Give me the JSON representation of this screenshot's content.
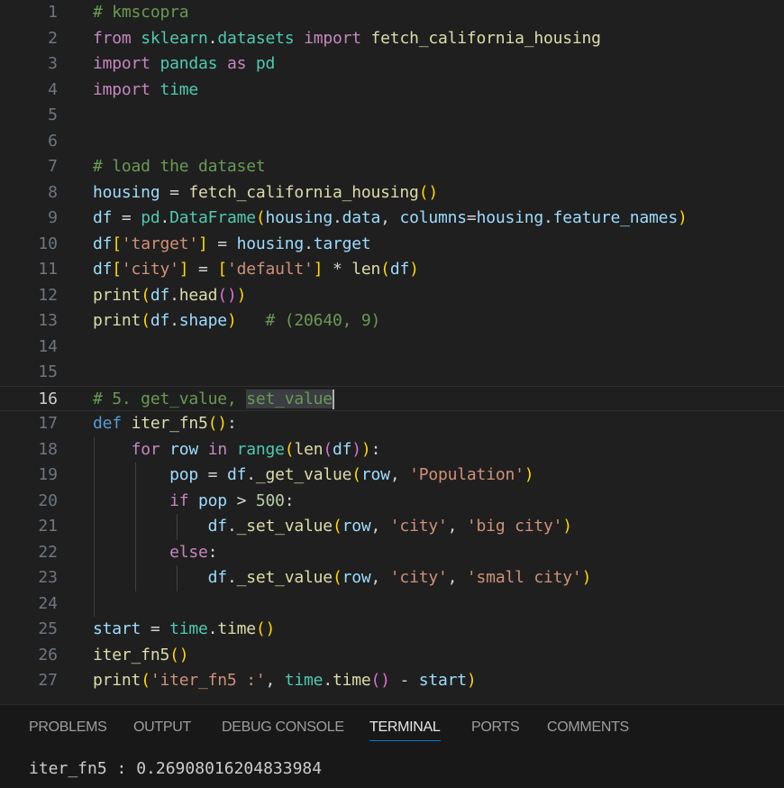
{
  "editor": {
    "active_line": 16,
    "lines": [
      {
        "n": "1",
        "tokens": [
          [
            "t-comment",
            "# kmscopra"
          ]
        ]
      },
      {
        "n": "2",
        "tokens": [
          [
            "t-kw",
            "from"
          ],
          [
            "t-plain",
            " "
          ],
          [
            "t-cls",
            "sklearn"
          ],
          [
            "t-plain",
            "."
          ],
          [
            "t-cls",
            "datasets"
          ],
          [
            "t-plain",
            " "
          ],
          [
            "t-kw",
            "import"
          ],
          [
            "t-plain",
            " "
          ],
          [
            "t-fn",
            "fetch_california_housing"
          ]
        ]
      },
      {
        "n": "3",
        "tokens": [
          [
            "t-kw",
            "import"
          ],
          [
            "t-plain",
            " "
          ],
          [
            "t-cls",
            "pandas"
          ],
          [
            "t-plain",
            " "
          ],
          [
            "t-kw",
            "as"
          ],
          [
            "t-plain",
            " "
          ],
          [
            "t-cls",
            "pd"
          ]
        ]
      },
      {
        "n": "4",
        "tokens": [
          [
            "t-kw",
            "import"
          ],
          [
            "t-plain",
            " "
          ],
          [
            "t-cls",
            "time"
          ]
        ]
      },
      {
        "n": "5",
        "tokens": []
      },
      {
        "n": "6",
        "tokens": []
      },
      {
        "n": "7",
        "tokens": [
          [
            "t-comment",
            "# load the dataset"
          ]
        ]
      },
      {
        "n": "8",
        "tokens": [
          [
            "t-var",
            "housing"
          ],
          [
            "t-plain",
            " = "
          ],
          [
            "t-fn",
            "fetch_california_housing"
          ],
          [
            "t-br1",
            "()"
          ]
        ]
      },
      {
        "n": "9",
        "tokens": [
          [
            "t-var",
            "df"
          ],
          [
            "t-plain",
            " = "
          ],
          [
            "t-cls",
            "pd"
          ],
          [
            "t-plain",
            "."
          ],
          [
            "t-cls",
            "DataFrame"
          ],
          [
            "t-br1",
            "("
          ],
          [
            "t-var",
            "housing"
          ],
          [
            "t-plain",
            "."
          ],
          [
            "t-var",
            "data"
          ],
          [
            "t-plain",
            ", "
          ],
          [
            "t-var",
            "columns"
          ],
          [
            "t-plain",
            "="
          ],
          [
            "t-var",
            "housing"
          ],
          [
            "t-plain",
            "."
          ],
          [
            "t-var",
            "feature_names"
          ],
          [
            "t-br1",
            ")"
          ]
        ]
      },
      {
        "n": "10",
        "tokens": [
          [
            "t-var",
            "df"
          ],
          [
            "t-br1",
            "["
          ],
          [
            "t-str",
            "'target'"
          ],
          [
            "t-br1",
            "]"
          ],
          [
            "t-plain",
            " = "
          ],
          [
            "t-var",
            "housing"
          ],
          [
            "t-plain",
            "."
          ],
          [
            "t-var",
            "target"
          ]
        ]
      },
      {
        "n": "11",
        "tokens": [
          [
            "t-var",
            "df"
          ],
          [
            "t-br1",
            "["
          ],
          [
            "t-str",
            "'city'"
          ],
          [
            "t-br1",
            "]"
          ],
          [
            "t-plain",
            " = "
          ],
          [
            "t-br1",
            "["
          ],
          [
            "t-str",
            "'default'"
          ],
          [
            "t-br1",
            "]"
          ],
          [
            "t-plain",
            " * "
          ],
          [
            "t-fn",
            "len"
          ],
          [
            "t-br1",
            "("
          ],
          [
            "t-var",
            "df"
          ],
          [
            "t-br1",
            ")"
          ]
        ]
      },
      {
        "n": "12",
        "tokens": [
          [
            "t-fn",
            "print"
          ],
          [
            "t-br1",
            "("
          ],
          [
            "t-var",
            "df"
          ],
          [
            "t-plain",
            "."
          ],
          [
            "t-fn",
            "head"
          ],
          [
            "t-br2",
            "()"
          ],
          [
            "t-br1",
            ")"
          ]
        ]
      },
      {
        "n": "13",
        "tokens": [
          [
            "t-fn",
            "print"
          ],
          [
            "t-br1",
            "("
          ],
          [
            "t-var",
            "df"
          ],
          [
            "t-plain",
            "."
          ],
          [
            "t-var",
            "shape"
          ],
          [
            "t-br1",
            ")"
          ],
          [
            "t-plain",
            "   "
          ],
          [
            "t-comment",
            "# (20640, 9)"
          ]
        ]
      },
      {
        "n": "14",
        "tokens": []
      },
      {
        "n": "15",
        "tokens": []
      },
      {
        "n": "16",
        "tokens": [
          [
            "t-comment",
            "# 5. get_value, "
          ],
          [
            "t-hl",
            "set_value"
          ]
        ]
      },
      {
        "n": "17",
        "tokens": [
          [
            "t-def",
            "def"
          ],
          [
            "t-plain",
            " "
          ],
          [
            "t-fn",
            "iter_fn5"
          ],
          [
            "t-br1",
            "()"
          ],
          [
            "t-plain",
            ":"
          ]
        ]
      },
      {
        "n": "18",
        "tokens": [
          [
            "t-plain",
            "    "
          ],
          [
            "t-kw",
            "for"
          ],
          [
            "t-plain",
            " "
          ],
          [
            "t-var",
            "row"
          ],
          [
            "t-plain",
            " "
          ],
          [
            "t-kw",
            "in"
          ],
          [
            "t-plain",
            " "
          ],
          [
            "t-cls",
            "range"
          ],
          [
            "t-br1",
            "("
          ],
          [
            "t-fn",
            "len"
          ],
          [
            "t-br2",
            "("
          ],
          [
            "t-var",
            "df"
          ],
          [
            "t-br2",
            ")"
          ],
          [
            "t-br1",
            ")"
          ],
          [
            "t-plain",
            ":"
          ]
        ]
      },
      {
        "n": "19",
        "tokens": [
          [
            "t-plain",
            "        "
          ],
          [
            "t-var",
            "pop"
          ],
          [
            "t-plain",
            " = "
          ],
          [
            "t-var",
            "df"
          ],
          [
            "t-plain",
            "."
          ],
          [
            "t-fn",
            "_get_value"
          ],
          [
            "t-br1",
            "("
          ],
          [
            "t-var",
            "row"
          ],
          [
            "t-plain",
            ", "
          ],
          [
            "t-str",
            "'Population'"
          ],
          [
            "t-br1",
            ")"
          ]
        ]
      },
      {
        "n": "20",
        "tokens": [
          [
            "t-plain",
            "        "
          ],
          [
            "t-kw",
            "if"
          ],
          [
            "t-plain",
            " "
          ],
          [
            "t-var",
            "pop"
          ],
          [
            "t-plain",
            " > "
          ],
          [
            "t-num",
            "500"
          ],
          [
            "t-plain",
            ":"
          ]
        ]
      },
      {
        "n": "21",
        "tokens": [
          [
            "t-plain",
            "            "
          ],
          [
            "t-var",
            "df"
          ],
          [
            "t-plain",
            "."
          ],
          [
            "t-fn",
            "_set_value"
          ],
          [
            "t-br1",
            "("
          ],
          [
            "t-var",
            "row"
          ],
          [
            "t-plain",
            ", "
          ],
          [
            "t-str",
            "'city'"
          ],
          [
            "t-plain",
            ", "
          ],
          [
            "t-str",
            "'big city'"
          ],
          [
            "t-br1",
            ")"
          ]
        ]
      },
      {
        "n": "22",
        "tokens": [
          [
            "t-plain",
            "        "
          ],
          [
            "t-kw",
            "else"
          ],
          [
            "t-plain",
            ":"
          ]
        ]
      },
      {
        "n": "23",
        "tokens": [
          [
            "t-plain",
            "            "
          ],
          [
            "t-var",
            "df"
          ],
          [
            "t-plain",
            "."
          ],
          [
            "t-fn",
            "_set_value"
          ],
          [
            "t-br1",
            "("
          ],
          [
            "t-var",
            "row"
          ],
          [
            "t-plain",
            ", "
          ],
          [
            "t-str",
            "'city'"
          ],
          [
            "t-plain",
            ", "
          ],
          [
            "t-str",
            "'small city'"
          ],
          [
            "t-br1",
            ")"
          ]
        ]
      },
      {
        "n": "24",
        "tokens": []
      },
      {
        "n": "25",
        "tokens": [
          [
            "t-var",
            "start"
          ],
          [
            "t-plain",
            " = "
          ],
          [
            "t-cls",
            "time"
          ],
          [
            "t-plain",
            "."
          ],
          [
            "t-fn",
            "time"
          ],
          [
            "t-br1",
            "()"
          ]
        ]
      },
      {
        "n": "26",
        "tokens": [
          [
            "t-fn",
            "iter_fn5"
          ],
          [
            "t-br1",
            "()"
          ]
        ]
      },
      {
        "n": "27",
        "tokens": [
          [
            "t-fn",
            "print"
          ],
          [
            "t-br1",
            "("
          ],
          [
            "t-str",
            "'iter_fn5 :'"
          ],
          [
            "t-plain",
            ", "
          ],
          [
            "t-cls",
            "time"
          ],
          [
            "t-plain",
            "."
          ],
          [
            "t-fn",
            "time"
          ],
          [
            "t-br2",
            "()"
          ],
          [
            "t-plain",
            " - "
          ],
          [
            "t-var",
            "start"
          ],
          [
            "t-br1",
            ")"
          ]
        ]
      }
    ]
  },
  "panel": {
    "tabs": [
      {
        "label": "PROBLEMS",
        "active": false
      },
      {
        "label": "OUTPUT",
        "active": false
      },
      {
        "label": "DEBUG CONSOLE",
        "active": false
      },
      {
        "label": "TERMINAL",
        "active": true
      },
      {
        "label": "PORTS",
        "active": false
      },
      {
        "label": "COMMENTS",
        "active": false
      }
    ],
    "terminal_output": "iter_fn5 : 0.26908016204833984"
  }
}
